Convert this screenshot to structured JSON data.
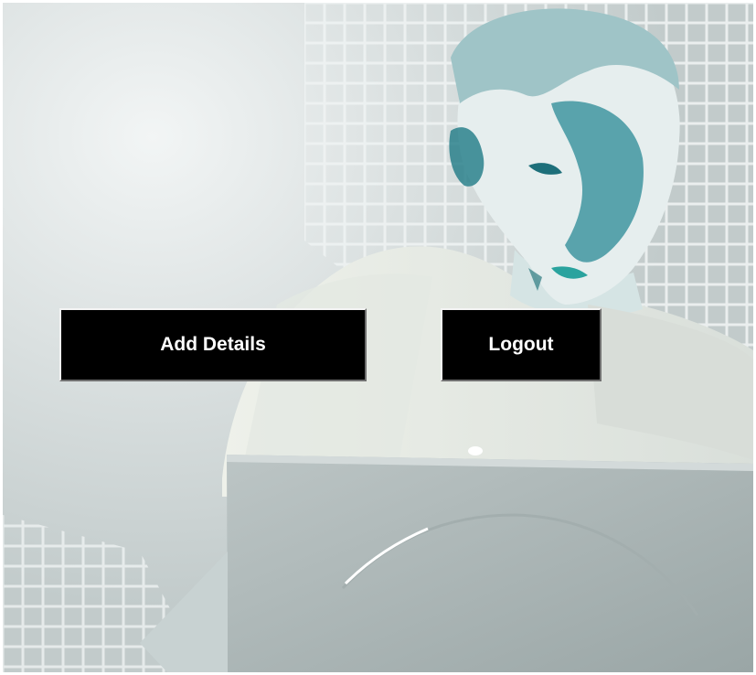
{
  "buttons": {
    "add_details_label": "Add Details",
    "logout_label": "Logout"
  },
  "colors": {
    "button_background": "#000000",
    "button_text": "#ffffff",
    "background_tint": "#cfd6d6",
    "figure_tint": "#2a8a96"
  },
  "background": {
    "icon": "man-with-laptop-illustration"
  }
}
